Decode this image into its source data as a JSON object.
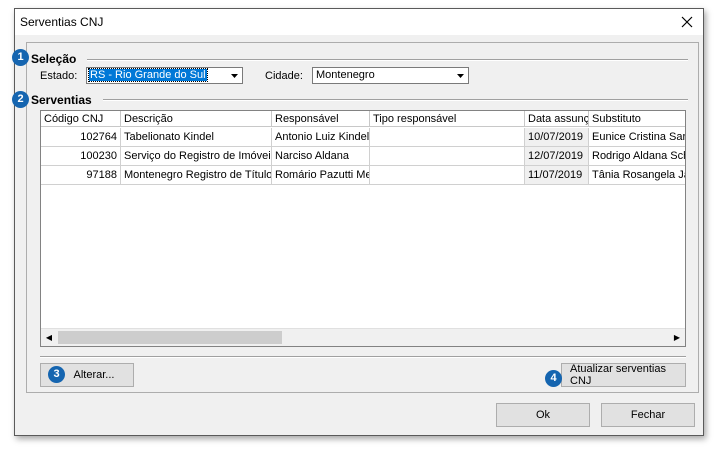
{
  "window": {
    "title": "Serventias CNJ"
  },
  "badges": {
    "b1": "1",
    "b2": "2",
    "b3": "3",
    "b4": "4"
  },
  "selecao": {
    "heading": "Seleção",
    "estado_label": "Estado:",
    "estado_value": "RS - Rio Grande do Sul",
    "cidade_label": "Cidade:",
    "cidade_value": "Montenegro"
  },
  "serventias": {
    "heading": "Serventias",
    "columns": [
      "Código CNJ",
      "Descrição",
      "Responsável",
      "Tipo responsável",
      "Data assunç",
      "Substituto"
    ],
    "rows": [
      [
        "102764",
        "Tabelionato Kindel",
        "Antonio Luiz Kindel",
        "",
        "10/07/2019",
        "Eunice Cristina Sarm"
      ],
      [
        "100230",
        "Serviço do Registro de Imóveis",
        "Narciso Aldana",
        "",
        "12/07/2019",
        "Rodrigo Aldana Sch"
      ],
      [
        "97188",
        "Montenegro Registro de Título",
        "Romário Pazutti Me",
        "",
        "11/07/2019",
        "Tânia Rosangela Ja"
      ]
    ]
  },
  "buttons": {
    "alterar": "Alterar...",
    "atualizar": "Atualizar serventias CNJ",
    "ok": "Ok",
    "fechar": "Fechar"
  },
  "colors": {
    "badge": "#1565b0",
    "selection": "#0078d7"
  }
}
